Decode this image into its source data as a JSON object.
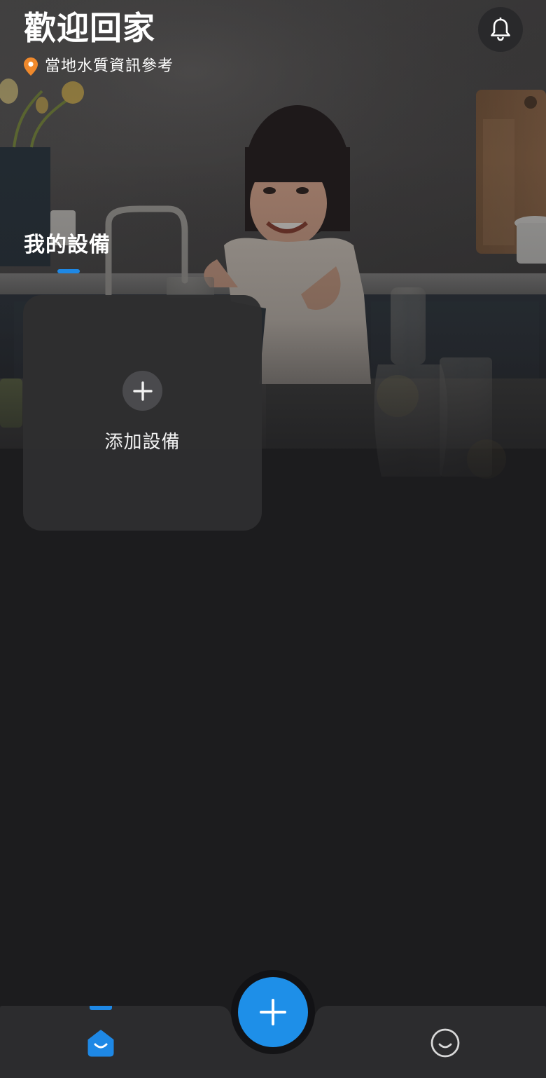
{
  "header": {
    "title": "歡迎回家",
    "location_link": "當地水質資訊參考",
    "icons": {
      "location": "location-pin-icon",
      "notifications": "bell-icon"
    }
  },
  "devices": {
    "section_title": "我的設備",
    "add_card": {
      "label": "添加設備",
      "icon": "plus-icon"
    }
  },
  "bottom_nav": {
    "items": [
      {
        "key": "home",
        "icon": "home-icon",
        "selected": true
      },
      {
        "key": "add",
        "icon": "plus-icon"
      },
      {
        "key": "profile",
        "icon": "smiley-icon",
        "selected": false
      }
    ]
  },
  "colors": {
    "accent": "#1e88e5",
    "location_pin": "#f0892c",
    "background": "#1c1c1e",
    "card": "#2e2e30",
    "nav_bar": "#2c2c2e"
  }
}
